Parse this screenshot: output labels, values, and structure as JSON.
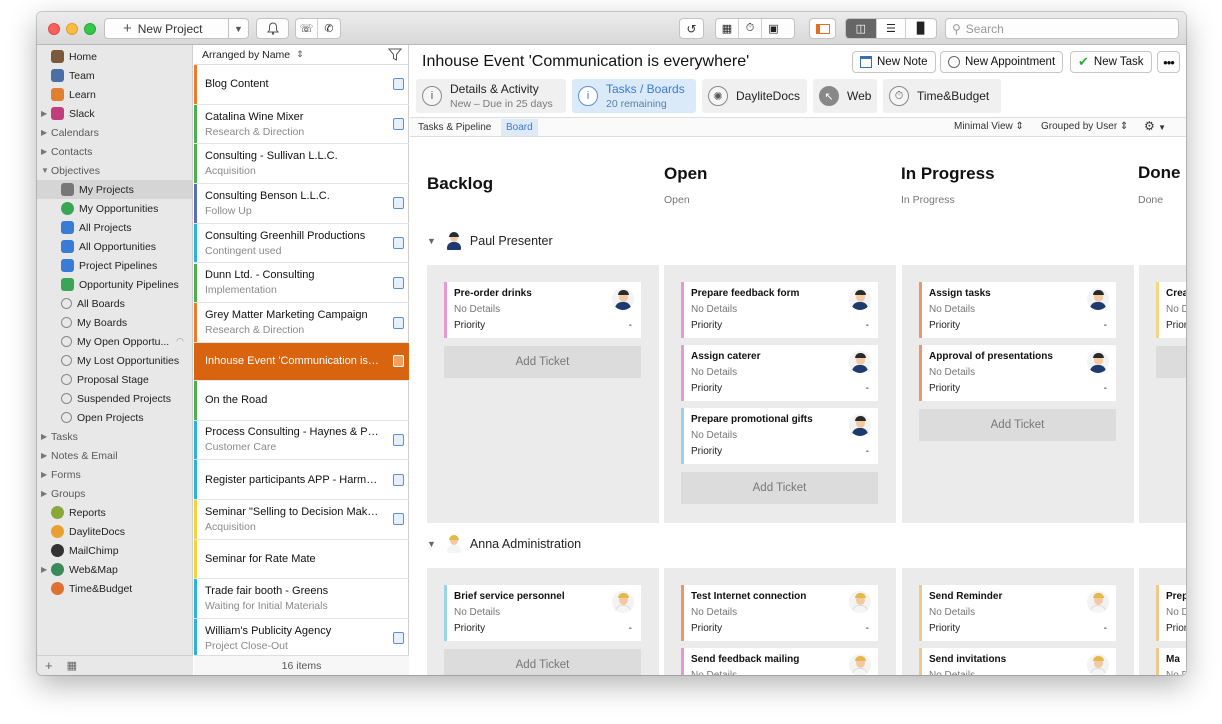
{
  "toolbar": {
    "new_project": "New Project",
    "search_placeholder": "Search"
  },
  "sidebar": {
    "items": [
      {
        "label": "Home",
        "icon": "home-icon",
        "color": "#7a5a3a"
      },
      {
        "label": "Team",
        "icon": "team-icon",
        "color": "#4a6fa5"
      },
      {
        "label": "Learn",
        "icon": "learn-icon",
        "color": "#e08030"
      },
      {
        "label": "Slack",
        "icon": "slack-icon",
        "color": "#c23e7a"
      },
      {
        "label": "Calendars",
        "icon": ""
      },
      {
        "label": "Contacts",
        "icon": ""
      },
      {
        "label": "Objectives",
        "icon": ""
      },
      {
        "label": "My Projects",
        "icon": "tool-icon",
        "color": "#777777"
      },
      {
        "label": "My Opportunities",
        "icon": "dollar-icon",
        "color": "#3aa655"
      },
      {
        "label": "All Projects",
        "icon": "board-icon",
        "color": "#3a7bd5"
      },
      {
        "label": "All Opportunities",
        "icon": "board-icon",
        "color": "#3a7bd5"
      },
      {
        "label": "Project Pipelines",
        "icon": "pipeline-icon",
        "color": "#3a7bd5"
      },
      {
        "label": "Opportunity Pipelines",
        "icon": "pipeline-icon",
        "color": "#3aa655"
      },
      {
        "label": "All Boards",
        "icon": "smart-filter-icon",
        "color": "#888888"
      },
      {
        "label": "My Boards",
        "icon": "smart-filter-icon",
        "color": "#888888"
      },
      {
        "label": "My Open Opportu...",
        "icon": "smart-filter-icon",
        "color": "#888888"
      },
      {
        "label": "My Lost Opportunities",
        "icon": "smart-filter-icon",
        "color": "#888888"
      },
      {
        "label": "Proposal Stage",
        "icon": "smart-filter-icon",
        "color": "#888888"
      },
      {
        "label": "Suspended Projects",
        "icon": "smart-filter-icon",
        "color": "#888888"
      },
      {
        "label": "Open Projects",
        "icon": "smart-filter-icon",
        "color": "#888888"
      },
      {
        "label": "Tasks",
        "icon": ""
      },
      {
        "label": "Notes & Email",
        "icon": ""
      },
      {
        "label": "Forms",
        "icon": ""
      },
      {
        "label": "Groups",
        "icon": ""
      },
      {
        "label": "Reports",
        "icon": "reports-icon",
        "color": "#8aa83a"
      },
      {
        "label": "DayliteDocs",
        "icon": "docs-icon",
        "color": "#e8a030"
      },
      {
        "label": "MailChimp",
        "icon": "mailchimp-icon",
        "color": "#333333"
      },
      {
        "label": "Web&Map",
        "icon": "globe-icon",
        "color": "#3a8a5a"
      },
      {
        "label": "Time&Budget",
        "icon": "timer-icon",
        "color": "#e07030"
      }
    ]
  },
  "list": {
    "header": "Arranged by Name",
    "footer": "16 items",
    "rows": [
      {
        "title": "Blog Content",
        "sub": "",
        "color": "#f07a2a",
        "icon": true
      },
      {
        "title": "Catalina Wine Mixer",
        "sub": "Research & Direction",
        "color": "#4caf50",
        "icon": true
      },
      {
        "title": "Consulting - Sullivan L.L.C.",
        "sub": "Acquisition",
        "color": "#4caf50",
        "icon": false
      },
      {
        "title": "Consulting Benson L.L.C.",
        "sub": "Follow Up",
        "color": "#5a6fb5",
        "icon": true
      },
      {
        "title": "Consulting Greenhill Productions",
        "sub": "Contingent used",
        "color": "#2ab3d6",
        "icon": true
      },
      {
        "title": "Dunn Ltd. - Consulting",
        "sub": "Implementation",
        "color": "#4caf50",
        "icon": true
      },
      {
        "title": "Grey Matter Marketing Campaign",
        "sub": "Research & Direction",
        "color": "#f07a2a",
        "icon": true
      },
      {
        "title": "Inhouse Event 'Communication is e...",
        "sub": "",
        "color": "#d9640f",
        "icon": true,
        "selected": true
      },
      {
        "title": "On the Road",
        "sub": "",
        "color": "#4caf50",
        "icon": false
      },
      {
        "title": "Process Consulting - Haynes & Par...",
        "sub": "Customer Care",
        "color": "#2ab3d6",
        "icon": true
      },
      {
        "title": "Register participants APP - Harmo...",
        "sub": "",
        "color": "#2ab3d6",
        "icon": true
      },
      {
        "title": "Seminar \"Selling to Decision Maker...",
        "sub": "Acquisition",
        "color": "#f2d33a",
        "icon": true
      },
      {
        "title": "Seminar for Rate Mate",
        "sub": "",
        "color": "#f2d33a",
        "icon": false
      },
      {
        "title": "Trade fair booth - Greens",
        "sub": "Waiting for Initial Materials",
        "color": "#2ab3d6",
        "icon": false
      },
      {
        "title": "William's Publicity Agency",
        "sub": "Project Close-Out",
        "color": "#2ab3d6",
        "icon": true
      }
    ]
  },
  "main": {
    "title": "Inhouse Event 'Communication is everywhere'",
    "buttons": {
      "new_note": "New Note",
      "new_appointment": "New Appointment",
      "new_task": "New Task"
    },
    "tabs": [
      {
        "label": "Details & Activity",
        "sub": "New – Due in 25 days"
      },
      {
        "label": "Tasks / Boards",
        "sub": "20 remaining"
      },
      {
        "label": "DayliteDocs",
        "sub": ""
      },
      {
        "label": "Web",
        "sub": ""
      },
      {
        "label": "Time&Budget",
        "sub": ""
      }
    ],
    "subtabs": [
      "Tasks & Pipeline",
      "Board"
    ],
    "view_mode": "Minimal View",
    "grouping": "Grouped by User"
  },
  "board": {
    "columns": [
      {
        "title": "Backlog",
        "sub": ""
      },
      {
        "title": "Open",
        "sub": "Open"
      },
      {
        "title": "In Progress",
        "sub": "In Progress"
      },
      {
        "title": "Done",
        "sub": "Done"
      }
    ],
    "add_label": "Add Ticket",
    "no_details": "No Details",
    "priority": "Priority",
    "dash": "-",
    "groups": [
      {
        "name": "Paul Presenter",
        "avatar": "male",
        "lanes": [
          [
            "Pre-order drinks"
          ],
          [
            "Prepare feedback form",
            "Assign caterer",
            "Prepare promotional gifts"
          ],
          [
            "Assign tasks",
            "Approval of presentations"
          ],
          [
            "Crea"
          ]
        ]
      },
      {
        "name": "Anna Administration",
        "avatar": "female",
        "lanes": [
          [
            "Brief service personnel"
          ],
          [
            "Test Internet connection",
            "Send feedback mailing"
          ],
          [
            "Send Reminder",
            "Send invitations"
          ],
          [
            "Prep",
            "Ma"
          ]
        ]
      }
    ],
    "card_colors": [
      [
        "#e59ad6"
      ],
      [
        "#e59ad6",
        "#e59ad6",
        "#9ad3ec"
      ],
      [
        "#f0946a",
        "#f0946a"
      ],
      [
        "#f2d884"
      ],
      [
        "#9ad3ec"
      ],
      [
        "#f0946a",
        "#e59ad6"
      ],
      [
        "#f2c88a",
        "#f2c88a"
      ],
      [
        "#f2c88a",
        "#f2c88a"
      ]
    ]
  }
}
